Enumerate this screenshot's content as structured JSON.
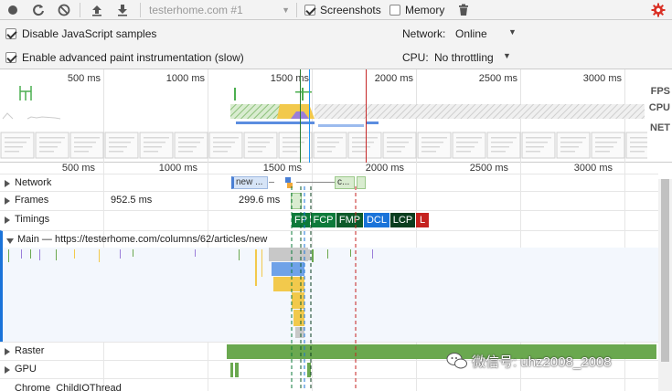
{
  "toolbar": {
    "recording_select": "testerhome.com #1",
    "screenshots_label": "Screenshots",
    "memory_label": "Memory",
    "screenshots_checked": true,
    "memory_checked": false
  },
  "settings": {
    "disable_js_samples": "Disable JavaScript samples",
    "advanced_paint": "Enable advanced paint instrumentation (slow)",
    "network_label": "Network:",
    "network_value": "Online",
    "cpu_label": "CPU:",
    "cpu_value": "No throttling"
  },
  "overview": {
    "ticks": [
      "500 ms",
      "1000 ms",
      "1500 ms",
      "2000 ms",
      "2500 ms",
      "3000 ms"
    ],
    "fps_label": "FPS",
    "cpu_label": "CPU",
    "net_label": "NET"
  },
  "flame": {
    "ticks": [
      "500 ms",
      "1000 ms",
      "1500 ms",
      "2000 ms",
      "2500 ms",
      "3000 ms"
    ],
    "tracks": {
      "network": "Network",
      "frames": "Frames",
      "timings": "Timings",
      "main": "Main — https://testerhome.com/columns/62/articles/new",
      "raster": "Raster",
      "gpu": "GPU",
      "child_io": "Chrome_ChildIOThread"
    },
    "frame_values": [
      "952.5 ms",
      "299.6 ms"
    ],
    "network_items": [
      "new ...",
      "c..."
    ],
    "timing_markers": [
      {
        "label": "FP",
        "color": "#0d7a3a"
      },
      {
        "label": "FCP",
        "color": "#0d7a3a"
      },
      {
        "label": "FMP",
        "color": "#0d5a2a"
      },
      {
        "label": "DCL",
        "color": "#1a73d9"
      },
      {
        "label": "LCP",
        "color": "#0a3d1e"
      },
      {
        "label": "L",
        "color": "#c5221f"
      }
    ]
  },
  "watermark": "微信号: uhz2008_2008",
  "colors": {
    "accent_red": "#d93025",
    "green": "#6aa84f",
    "scripting_yellow": "#f2c94c",
    "rendering_purple": "#9b7ed9",
    "painting_blue": "#6fa2e8"
  }
}
